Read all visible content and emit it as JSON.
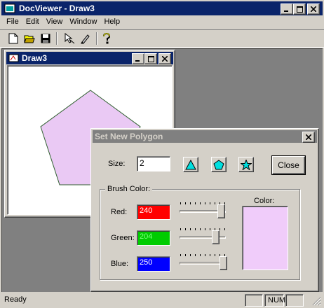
{
  "app": {
    "title": "DocViewer - Draw3",
    "title_color": "#0a246a",
    "workspace_color": "#808080"
  },
  "menu": [
    {
      "label": "File"
    },
    {
      "label": "Edit"
    },
    {
      "label": "View"
    },
    {
      "label": "Window"
    },
    {
      "label": "Help"
    }
  ],
  "toolbar": {
    "icons": [
      "new-document-icon",
      "open-folder-icon",
      "save-icon",
      "pointer-icon",
      "pen-icon",
      "help-icon"
    ]
  },
  "child_window": {
    "title": "Draw3",
    "polygon_fill": "#eac9f4",
    "polygon_sides": 5
  },
  "dialog": {
    "title": "Set New Polygon",
    "title_color": "#808080",
    "size_label": "Size:",
    "size_value": "2",
    "close_label": "Close",
    "shape_buttons": [
      "triangle-icon",
      "pentagon-icon",
      "star-icon"
    ],
    "group_label": "Brush Color:",
    "color_label": "Color:",
    "channels": [
      {
        "name": "Red:",
        "value": "240",
        "swatch": "#ff0000",
        "level": 0.94
      },
      {
        "name": "Green:",
        "value": "204",
        "swatch": "#00cc00",
        "level": 0.8
      },
      {
        "name": "Blue:",
        "value": "250",
        "swatch": "#0000ff",
        "level": 0.98
      }
    ],
    "preview_color": "#f0ccfa"
  },
  "status": {
    "text": "Ready",
    "num": "NUM"
  }
}
